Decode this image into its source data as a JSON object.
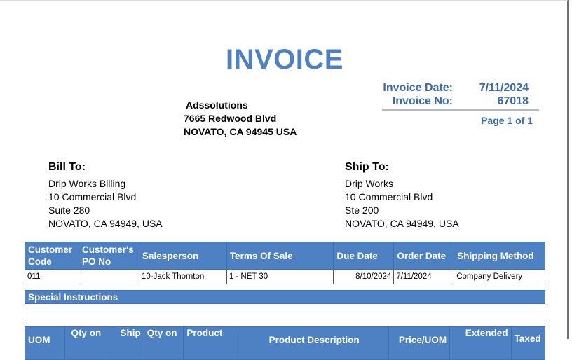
{
  "invoice": {
    "title": "INVOICE",
    "date_label": "Invoice Date:",
    "date": "7/11/2024",
    "number_label": "Invoice No:",
    "number": "67018",
    "page": "Page 1 of 1"
  },
  "company": {
    "name": "Adssolutions",
    "address1": "7665 Redwood Blvd",
    "address2": "NOVATO, CA 94945 USA"
  },
  "bill_to": {
    "header": "Bill To:",
    "lines": [
      "Drip Works Billing",
      "10 Commercial Blvd",
      "Suite 280",
      "NOVATO, CA 94949, USA"
    ]
  },
  "ship_to": {
    "header": "Ship To:",
    "lines": [
      "Drip Works",
      "10 Commercial Blvd",
      "Ste 200",
      "NOVATO, CA 94949, USA"
    ]
  },
  "info_table": {
    "headers": [
      "Customer Code",
      "Customer's PO No",
      "Salesperson",
      "Terms Of Sale",
      "Due Date",
      "Order Date",
      "Shipping Method"
    ],
    "row": [
      "011",
      "",
      "10-Jack Thornton",
      "1 - NET 30",
      "8/10/2024",
      "7/11/2024",
      "Company Delivery"
    ]
  },
  "special": {
    "header": "Special Instructions",
    "text": ""
  },
  "line_table": {
    "headers": [
      "UOM",
      "Qty on",
      "Ship",
      "Qty on",
      "Product",
      "Product Description",
      "Price/UOM",
      "Extended",
      "Taxed"
    ]
  },
  "colors": {
    "accent": "#4e81c4",
    "meta_text": "#3a6aa8"
  }
}
